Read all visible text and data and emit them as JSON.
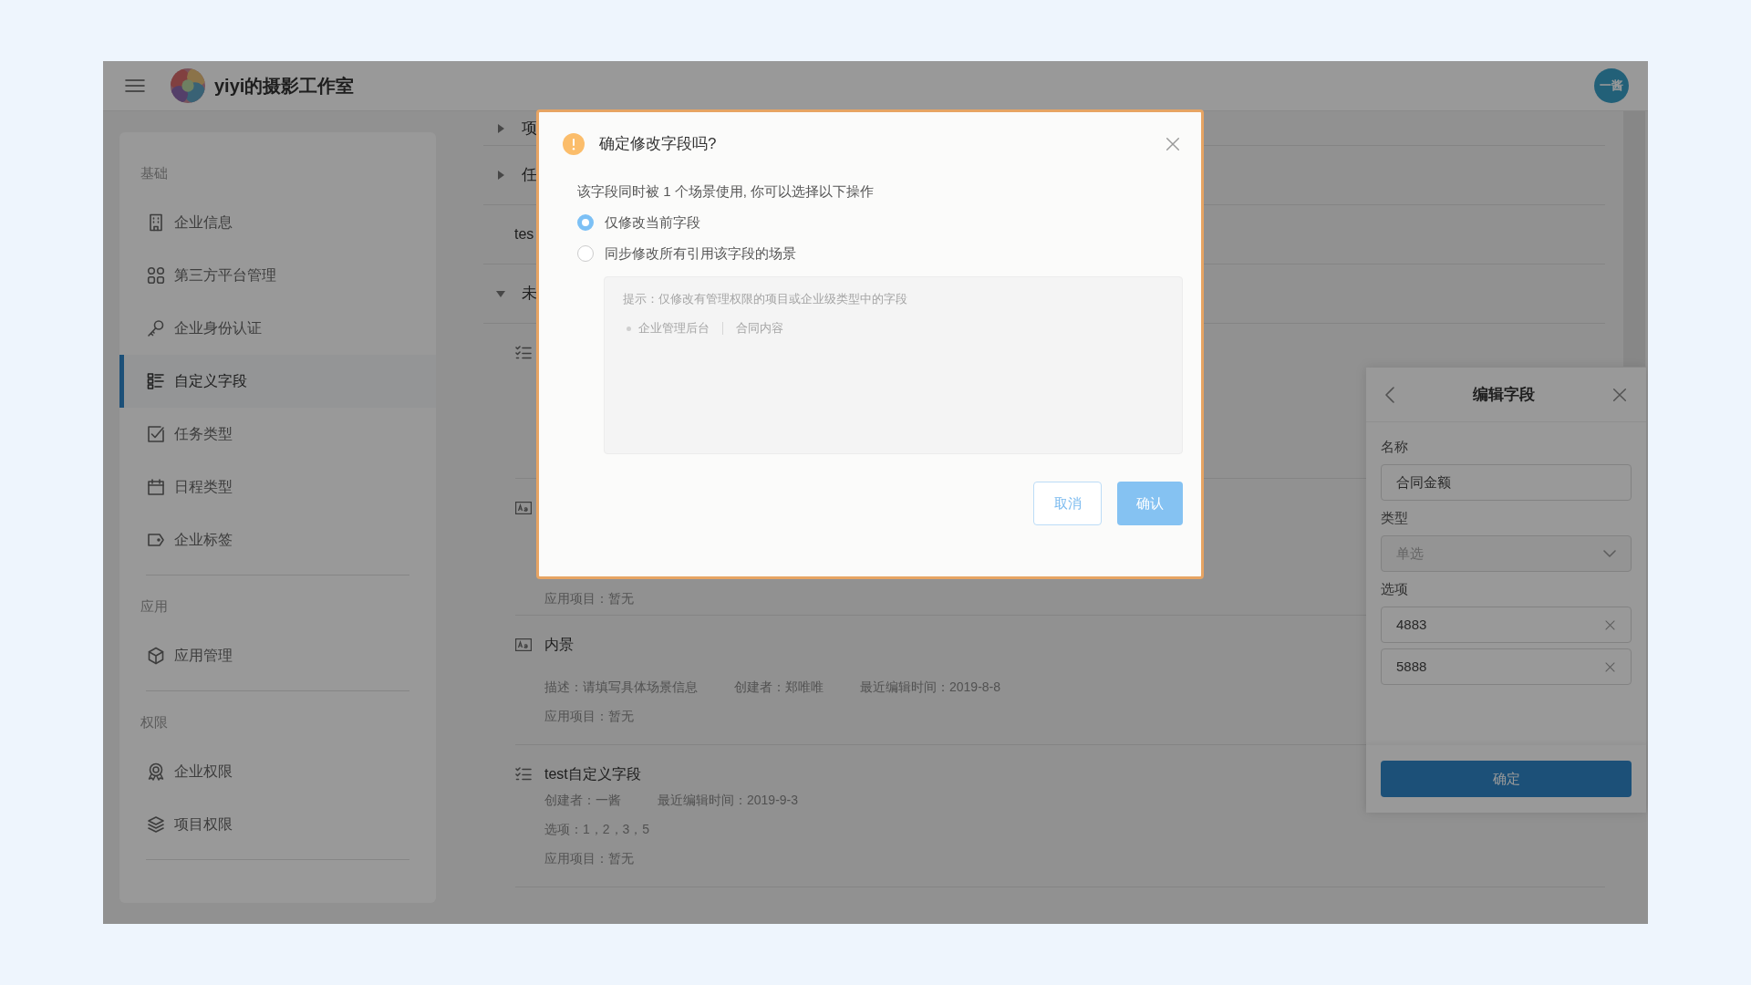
{
  "header": {
    "title": "yiyi的摄影工作室",
    "user": "一酱"
  },
  "sidebar": {
    "sections": [
      {
        "heading": "基础",
        "items": [
          {
            "label": "企业信息",
            "selected": false
          },
          {
            "label": "第三方平台管理",
            "selected": false
          },
          {
            "label": "企业身份认证",
            "selected": false
          },
          {
            "label": "自定义字段",
            "selected": true
          },
          {
            "label": "任务类型",
            "selected": false
          },
          {
            "label": "日程类型",
            "selected": false
          },
          {
            "label": "企业标签",
            "selected": false
          }
        ]
      },
      {
        "heading": "应用",
        "items": [
          {
            "label": "应用管理",
            "selected": false
          }
        ]
      },
      {
        "heading": "权限",
        "items": [
          {
            "label": "企业权限",
            "selected": false
          },
          {
            "label": "项目权限",
            "selected": false
          }
        ]
      }
    ]
  },
  "content": {
    "rows": [
      {
        "kind": "group",
        "label": "项",
        "expanded": false
      },
      {
        "kind": "group",
        "label": "任",
        "expanded": false
      },
      {
        "kind": "plain",
        "label": "tes"
      },
      {
        "kind": "group",
        "label": "未",
        "expanded": true
      }
    ],
    "fields": [
      {
        "kind": "choice"
      },
      {
        "kind": "text",
        "lines": [
          [
            "应用项目：暂无"
          ]
        ]
      },
      {
        "kind": "text",
        "title": "内景",
        "lines": [
          [
            "描述：请填写具体场景信息",
            "创建者：郑唯唯",
            "最近编辑时间：2019-8-8"
          ],
          [
            "应用项目：暂无"
          ]
        ]
      },
      {
        "kind": "choice",
        "title": "test自定义字段",
        "lines": [
          [
            "创建者：一酱",
            "最近编辑时间：2019-9-3"
          ],
          [
            "选项：1，2，3，5"
          ],
          [
            "应用项目：暂无"
          ]
        ]
      }
    ]
  },
  "edit_panel": {
    "title": "编辑字段",
    "fields": [
      {
        "kind": "input",
        "label": "名称",
        "value": "合同金额",
        "disabled": false
      },
      {
        "kind": "select",
        "label": "类型",
        "value": "单选",
        "disabled": true
      },
      {
        "kind": "options",
        "label": "选项",
        "values": [
          "4883",
          "5888"
        ],
        "disabled": false
      }
    ],
    "submit": "确定"
  },
  "dialog": {
    "title": "确定修改字段吗?",
    "message": "该字段同时被 1 个场景使用, 你可以选择以下操作",
    "options": [
      {
        "label": "仅修改当前字段",
        "selected": true
      },
      {
        "label": "同步修改所有引用该字段的场景",
        "selected": false
      }
    ],
    "hint": "提示：仅修改有管理权限的项目或企业级类型中的字段",
    "usages": [
      {
        "source": "企业管理后台",
        "name": "合同内容"
      }
    ],
    "cancel": "取消",
    "confirm": "确认"
  }
}
